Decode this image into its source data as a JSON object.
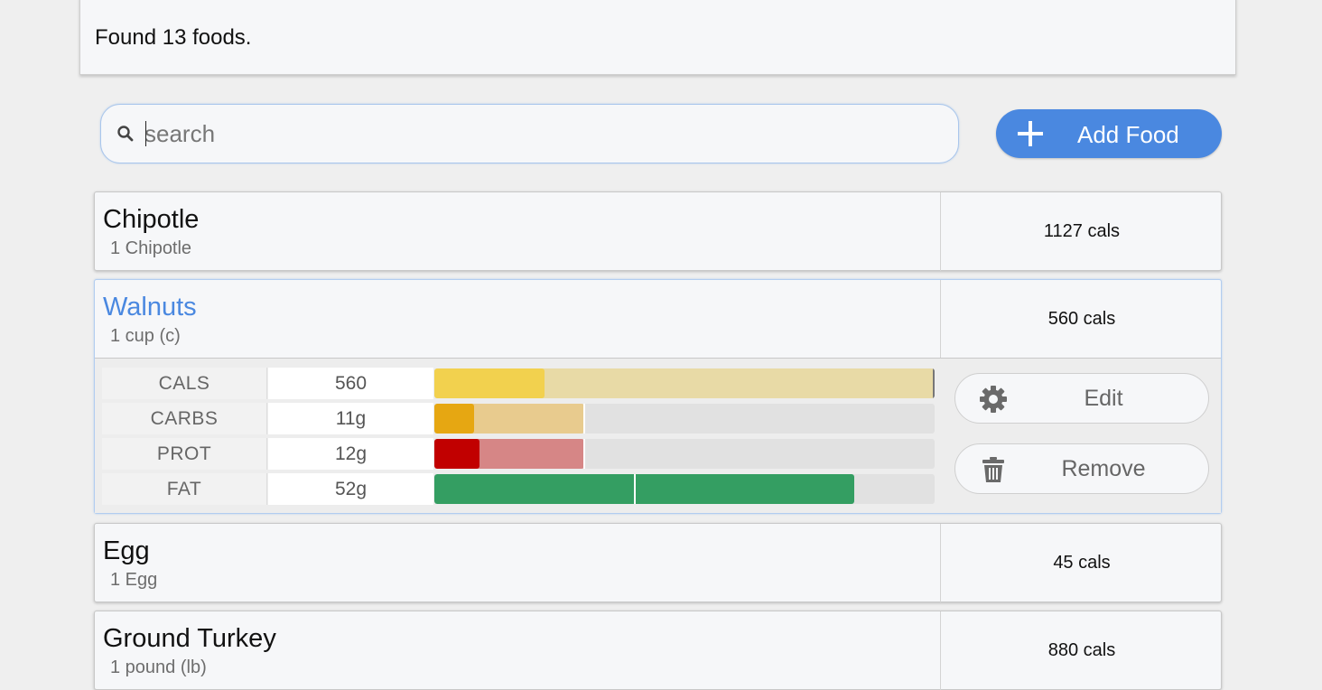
{
  "status": {
    "text": "Found 13 foods."
  },
  "search": {
    "placeholder": "search",
    "value": ""
  },
  "add_button": {
    "label": "Add Food",
    "icon": "plus-icon"
  },
  "foods": [
    {
      "name": "Chipotle",
      "serving": "1 Chipotle",
      "cals": "1127 cals"
    },
    {
      "name": "Walnuts",
      "serving": "1 cup (c)",
      "cals": "560 cals",
      "selected": true
    },
    {
      "name": "Egg",
      "serving": "1 Egg",
      "cals": "45 cals"
    },
    {
      "name": "Ground Turkey",
      "serving": "1 pound (lb)",
      "cals": "880 cals"
    }
  ],
  "detail": {
    "macros": [
      {
        "label": "CALS",
        "value": "560",
        "fill": 0.22,
        "target": 1.0,
        "color": "#f2d14e",
        "target_color": "#e8daa6"
      },
      {
        "label": "CARBS",
        "value": "11g",
        "fill": 0.08,
        "target": 0.3,
        "color": "#e6a712",
        "target_color": "#e8cb8e"
      },
      {
        "label": "PROT",
        "value": "12g",
        "fill": 0.09,
        "target": 0.3,
        "color": "#c10000",
        "target_color": "#d68686"
      },
      {
        "label": "FAT",
        "value": "52g",
        "fill": 0.84,
        "target": 0.4,
        "color": "#349e62",
        "target_color": "#349e62"
      }
    ],
    "edit_label": "Edit",
    "remove_label": "Remove"
  },
  "colors": {
    "accent": "#4a88e0",
    "background": "#efefef",
    "card": "#f6f7f9"
  }
}
